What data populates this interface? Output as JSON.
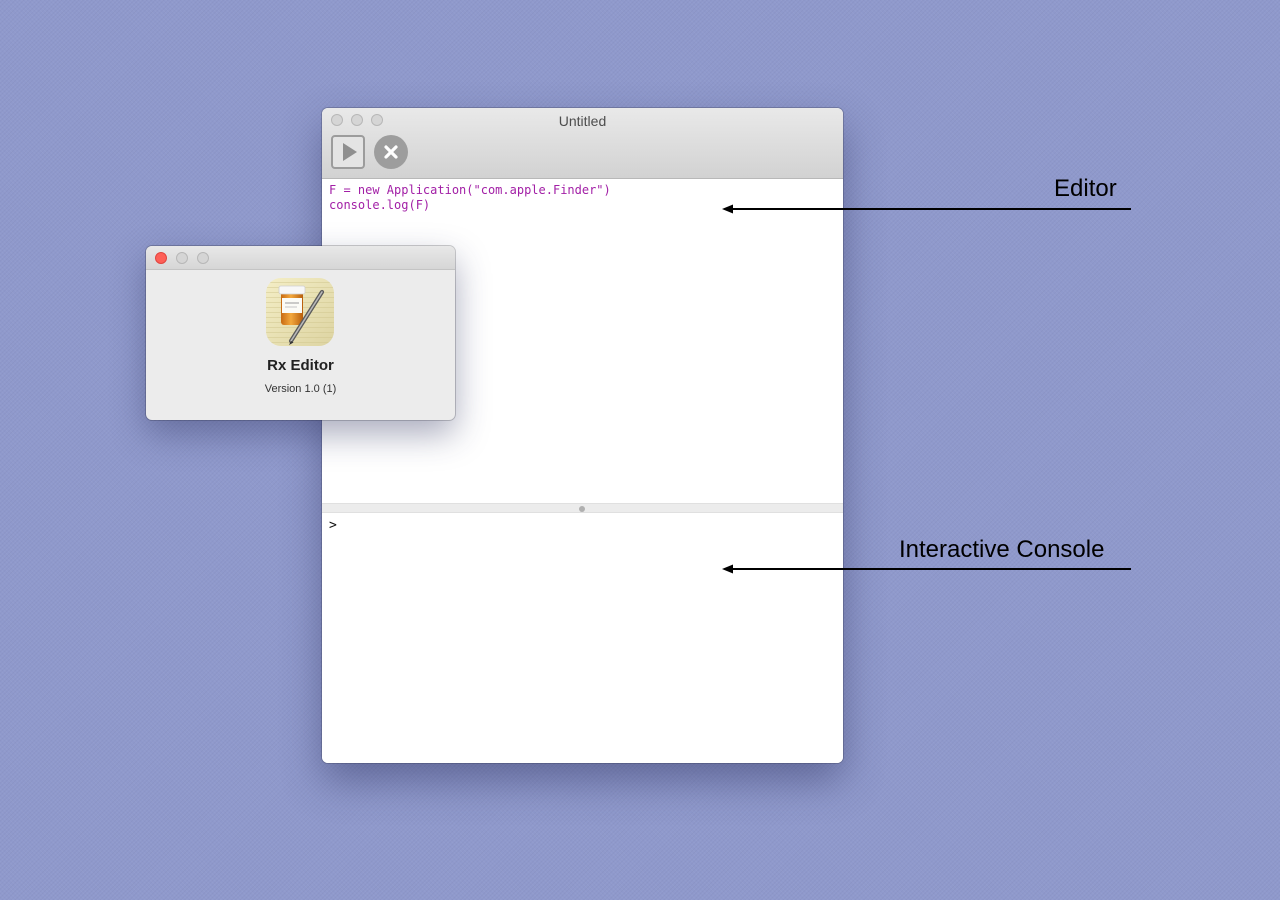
{
  "main_window": {
    "title": "Untitled",
    "toolbar": {
      "run_icon": "play-icon",
      "stop_icon": "stop-x-icon"
    },
    "editor": {
      "lines": [
        "F = new Application(\"com.apple.Finder\")",
        "console.log(F)"
      ],
      "text_color": "#a21fa6"
    },
    "console": {
      "prompt": ">"
    }
  },
  "about_window": {
    "app_icon": "rx-editor-app-icon",
    "app_name": "Rx Editor",
    "version": "Version 1.0 (1)"
  },
  "annotations": {
    "editor_label": "Editor",
    "console_label": "Interactive Console"
  },
  "colors": {
    "desktop": "#8f99cc",
    "close_button": "#fe5f57"
  }
}
